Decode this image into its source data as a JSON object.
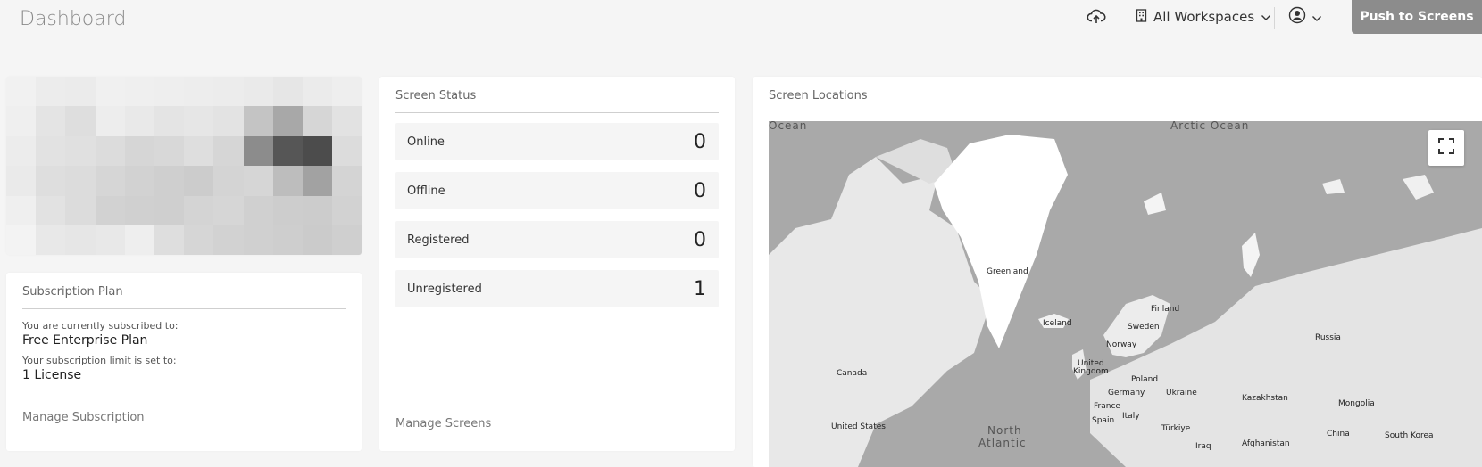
{
  "header": {
    "title": "Dashboard",
    "upload_icon": "cloud-upload-icon",
    "workspace_label": "All Workspaces",
    "push_button": "Push to Screens"
  },
  "logo_card": {
    "pixels": [
      [
        "#f1f1f1",
        "#ececec",
        "#ebebeb",
        "#f0f0f0",
        "#efefef",
        "#eeeeee",
        "#ededed",
        "#ececec",
        "#eaeaea",
        "#e6e6e6",
        "#ebebeb",
        "#eeeeee"
      ],
      [
        "#efefef",
        "#e4e4e4",
        "#dedede",
        "#ededed",
        "#e9e9e9",
        "#e4e4e4",
        "#e6e6e6",
        "#e3e3e3",
        "#c4c4c4",
        "#a8a8a8",
        "#d6d6d6",
        "#e2e2e2"
      ],
      [
        "#ececec",
        "#e2e2e2",
        "#e0e0e0",
        "#dcdcdc",
        "#d6d6d6",
        "#d8d8d8",
        "#dedede",
        "#d6d6d6",
        "#8c8c8c",
        "#565656",
        "#4c4c4c",
        "#dcdcdc"
      ],
      [
        "#eaeaea",
        "#dedede",
        "#dcdcdc",
        "#d6d6d6",
        "#d2d2d2",
        "#cfcfcf",
        "#cccccc",
        "#d4d4d4",
        "#d6d6d6",
        "#bdbdbd",
        "#a2a2a2",
        "#d4d4d4"
      ],
      [
        "#efefef",
        "#e2e2e2",
        "#dcdcdc",
        "#d2d2d2",
        "#d0d0d0",
        "#cfcfcf",
        "#d4d4d4",
        "#d6d6d6",
        "#d0d0d0",
        "#cdcdcd",
        "#cccccc",
        "#d2d2d2"
      ],
      [
        "#f3f3f3",
        "#e8e8e8",
        "#e6e6e6",
        "#e8e8e8",
        "#eeeeee",
        "#dedede",
        "#d6d6d6",
        "#d2d2d2",
        "#d0d0d0",
        "#cecece",
        "#cbcbcb",
        "#cfcfcf"
      ]
    ]
  },
  "subscription": {
    "title": "Subscription Plan",
    "subscribed_label": "You are currently subscribed to:",
    "plan": "Free Enterprise Plan",
    "limit_label": "Your subscription limit is set to:",
    "limit": "1 License",
    "manage_link": "Manage Subscription"
  },
  "screen_status": {
    "title": "Screen Status",
    "rows": [
      {
        "label": "Online",
        "count": "0"
      },
      {
        "label": "Offline",
        "count": "0"
      },
      {
        "label": "Registered",
        "count": "0"
      },
      {
        "label": "Unregistered",
        "count": "1"
      }
    ],
    "manage_link": "Manage Screens"
  },
  "screen_locations": {
    "title": "Screen Locations",
    "expand_icon": "fullscreen-icon",
    "ocean_labels": {
      "ocean_left": "Ocean",
      "arctic": "Arctic Ocean",
      "north_atlantic_1": "North",
      "north_atlantic_2": "Atlantic"
    },
    "place_labels": {
      "greenland": "Greenland",
      "iceland": "Iceland",
      "finland": "Finland",
      "sweden": "Sweden",
      "norway": "Norway",
      "russia": "Russia",
      "canada": "Canada",
      "uk_1": "United",
      "uk_2": "Kingdom",
      "poland": "Poland",
      "germany": "Germany",
      "ukraine": "Ukraine",
      "kazakhstan": "Kazakhstan",
      "mongolia": "Mongolia",
      "france": "France",
      "italy": "Italy",
      "spain": "Spain",
      "us": "United States",
      "turkiye": "Türkiye",
      "china": "China",
      "south_korea": "South Korea",
      "iraq": "Iraq",
      "afghanistan": "Afghanistan"
    }
  }
}
